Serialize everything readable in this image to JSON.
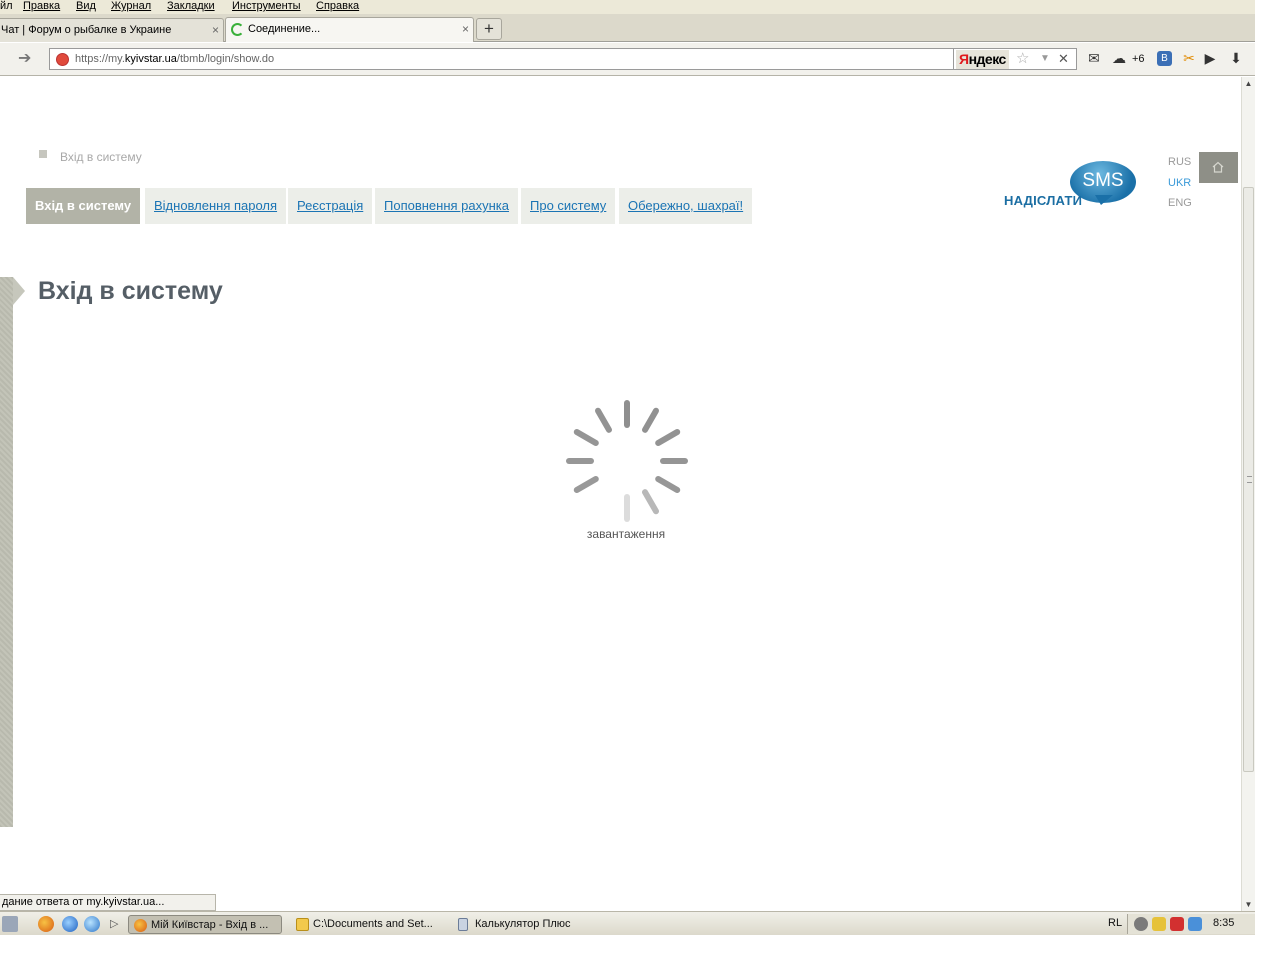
{
  "menubar": {
    "items": [
      "йл",
      "Правка",
      "Вид",
      "Журнал",
      "Закладки",
      "Инструменты",
      "Справка"
    ]
  },
  "tabs": [
    {
      "title": "Чат | Форум о рыбалке в Украине",
      "active": false
    },
    {
      "title": "Соединение...",
      "active": true
    }
  ],
  "newtab_label": "+",
  "close_glyph": "×",
  "address": {
    "prefix": "https://my.",
    "host": "kyivstar.ua",
    "path": "/tbmb/login/show.do"
  },
  "yandex": {
    "y": "Я",
    "rest": "ндекс"
  },
  "weather_count": "+6",
  "page": {
    "breadcrumb": "Вхід в систему",
    "nav_tabs": [
      {
        "label": "Вхід в систему",
        "active": true
      },
      {
        "label": "Відновлення пароля",
        "active": false
      },
      {
        "label": "Реєстрація",
        "active": false
      },
      {
        "label": "Поповнення рахунка",
        "active": false
      },
      {
        "label": "Про систему",
        "active": false
      },
      {
        "label": "Обережно, шахраї!",
        "active": false
      }
    ],
    "sms_bubble": "SMS",
    "sms_send": "НАДІСЛАТИ",
    "languages": [
      {
        "code": "RUS",
        "active": false
      },
      {
        "code": "UKR",
        "active": true
      },
      {
        "code": "ENG",
        "active": false
      }
    ],
    "title": "Вхід в систему",
    "loading_text": "завантаження"
  },
  "statusbar_text": "дание ответа от my.kyivstar.ua...",
  "taskbar": {
    "buttons": [
      {
        "label": "Мій Київстар - Вхід в ...",
        "active": true,
        "icon": "firefox-icon"
      },
      {
        "label": "C:\\Documents and Set...",
        "active": false,
        "icon": "folder-icon"
      },
      {
        "label": "Калькулятор Плюс",
        "active": false,
        "icon": "calculator-icon"
      }
    ],
    "lang": "RL",
    "clock": "8:35"
  },
  "colors": {
    "brand_blue": "#1b74b4",
    "active_tab": "#b2b3a7",
    "title": "#555e66"
  }
}
